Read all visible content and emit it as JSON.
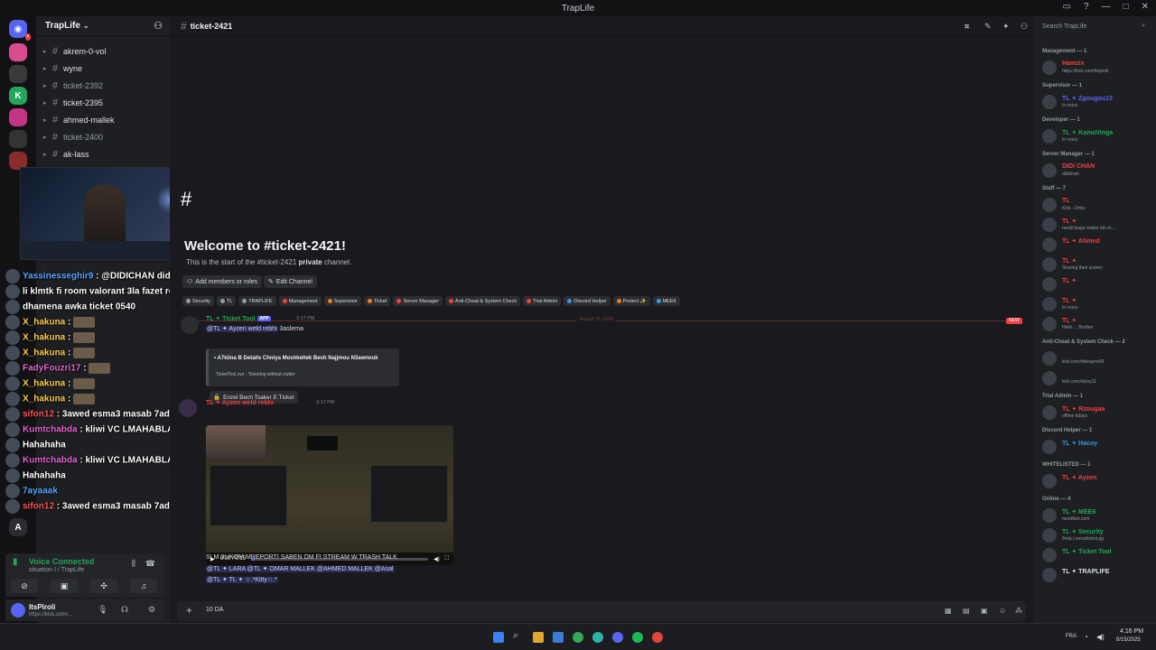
{
  "window": {
    "title": "TrapLife"
  },
  "server": {
    "name": "TrapLife"
  },
  "channels": [
    {
      "name": "akrem-0-vol",
      "bright": true
    },
    {
      "name": "wyne",
      "bright": true
    },
    {
      "name": "ticket-2392",
      "bright": false
    },
    {
      "name": "ticket-2395",
      "bright": true
    },
    {
      "name": "ahmed-mallek",
      "bright": true
    },
    {
      "name": "ticket-2400",
      "bright": false
    },
    {
      "name": "ak-lass",
      "bright": true
    }
  ],
  "stream_chat": [
    {
      "name": "Yassinesseghir9",
      "text": " : @DIDICHAN didi ena",
      "color": "blue"
    },
    {
      "name": "",
      "text": "li klmtk fi room valorant 3la fazet remove",
      "color": ""
    },
    {
      "name": "",
      "text": "dhamena awka ticket 0540",
      "color": ""
    },
    {
      "name": "X_hakuna",
      "text": " :",
      "color": "yellow"
    },
    {
      "name": "X_hakuna",
      "text": " :",
      "color": "yellow"
    },
    {
      "name": "X_hakuna",
      "text": " :",
      "color": "yellow"
    },
    {
      "name": "FadyFouzri17",
      "text": " :",
      "color": "pink"
    },
    {
      "name": "X_hakuna",
      "text": " :",
      "color": "yellow"
    },
    {
      "name": "X_hakuna",
      "text": " :",
      "color": "yellow"
    },
    {
      "name": "sifon12",
      "text": " : 3awed esma3 masab 7ad",
      "color": "red"
    },
    {
      "name": "Kumtchabda",
      "text": " : kliwi VC LMAHABLA",
      "color": "pink"
    },
    {
      "name": "",
      "text": "Hahahaha",
      "color": ""
    },
    {
      "name": "Kumtchabda",
      "text": " : kliwi VC LMAHABLA",
      "color": "pink"
    },
    {
      "name": "",
      "text": "Hahahaha",
      "color": ""
    },
    {
      "name": "7ayaaak",
      "text": "",
      "color": "blue"
    },
    {
      "name": "sifon12",
      "text": " : 3awed esma3 masab 7ad",
      "color": "red"
    }
  ],
  "voice": {
    "status": "Voice Connected",
    "channel": "situation I / TrapLife"
  },
  "user": {
    "name": "ItsPiroli",
    "status": "https://kick.com/..."
  },
  "main": {
    "channel_name": "ticket-2421",
    "welcome_title": "Welcome to #ticket-2421!",
    "welcome_sub_prefix": "This is the start of the #ticket-2421 ",
    "welcome_sub_bold": "private",
    "welcome_sub_suffix": " channel.",
    "add_members_label": "Add members or roles",
    "edit_channel_label": "Edit Channel",
    "role_tags": [
      {
        "label": "Security",
        "color": "#949ba4"
      },
      {
        "label": "TL",
        "color": "#949ba4"
      },
      {
        "label": "TRAPLIFE",
        "color": "#949ba4"
      },
      {
        "label": "Management",
        "color": "#f23f43"
      },
      {
        "label": "Supervisor",
        "color": "#e67e22"
      },
      {
        "label": "Ticket",
        "color": "#e67e22"
      },
      {
        "label": "Server Manager",
        "color": "#f23f43"
      },
      {
        "label": "Anti-Cheat & System Check",
        "color": "#f23f43"
      },
      {
        "label": "Trial Admin",
        "color": "#f23f43"
      },
      {
        "label": "Discord Helper",
        "color": "#3498db"
      },
      {
        "label": "Protect ✨",
        "color": "#e67e22"
      },
      {
        "label": "MEE6",
        "color": "#3498db"
      }
    ],
    "date_divider": "August 15, 2025",
    "new_label": "NEW",
    "messages": {
      "bot": {
        "author": "TL ✦ Ticket Tool",
        "badge": "APP",
        "time": "3:17 PM",
        "mention_user": "@TL ✦ Ayzen weld rebhi",
        "text_after": " 3aslema",
        "embed_title": "• A7kiina B Details Chniya Moshkeltek Bech Najjmou N3awnouk",
        "embed_footer": "TicketTool.xyz - Ticketing without clutter",
        "button_label": "Enzel Bech Tsaker E Ticket"
      },
      "user": {
        "author": "TL ✦ Ayzen weld rebhi",
        "time": "3:17 PM",
        "video_time": "0:00 / 0:15",
        "video_progress": 0.0,
        "text_line1": "SLM 3LIKOM MREPORTI  SABEN OM FI STREAM W TRASH TALK",
        "mentions_line2": "@TL ✦ LARA  @TL ✦ OMAR MALLEK  @AHMED MALLEK  @Asal",
        "mentions_line3": "@TL ✦ TL ✦ ☆.*Kitty☆.*"
      }
    },
    "composer_value": "10 DA"
  },
  "members": {
    "search_placeholder": "Search TrapLife",
    "groups": [
      {
        "title": "Management — 1",
        "members": [
          {
            "name": "Hamzix",
            "status": "https://kick.com/itspiroli",
            "color": "#f23f43"
          }
        ]
      },
      {
        "title": "Supervisor — 1",
        "members": [
          {
            "name": "TL ✦ Zgougou13",
            "status": "In voice",
            "color": "#5865f2"
          }
        ]
      },
      {
        "title": "Developer — 1",
        "members": [
          {
            "name": "TL ✦ KamaVinga",
            "status": "In voice",
            "color": "#23a55a"
          }
        ]
      },
      {
        "title": "Server Manager — 1",
        "members": [
          {
            "name": "DIDI CHAN",
            "status": "didichan",
            "color": "#f23f43"
          }
        ]
      },
      {
        "title": "Staff — 7",
        "members": [
          {
            "name": "TL",
            "status": "Kick : Zmfa",
            "color": "#f23f43"
          },
          {
            "name": "TL ✦",
            "status": "medii blage maker bih el...",
            "color": "#f23f43"
          },
          {
            "name": "TL ✦ Ahmed",
            "status": "",
            "color": "#f23f43"
          },
          {
            "name": "TL ✦",
            "status": "Sharing their screen",
            "color": "#f23f43"
          },
          {
            "name": "TL ✦",
            "status": "",
            "color": "#f23f43"
          },
          {
            "name": "TL ✦",
            "status": "In voice",
            "color": "#f23f43"
          },
          {
            "name": "TL ✦",
            "status": "Hello ... Brother",
            "color": "#f23f43"
          }
        ]
      },
      {
        "title": "Anti-Cheat & System Check — 2",
        "members": [
          {
            "name": "",
            "status": "kick.com/ddwayne69",
            "color": "#f23f43"
          },
          {
            "name": "",
            "status": "kick.com/stony11",
            "color": "#f23f43"
          }
        ]
      },
      {
        "title": "Trial Admin — 1",
        "members": [
          {
            "name": "TL ✦ Rzougaa",
            "status": "offline bdays",
            "color": "#f23f43"
          }
        ]
      },
      {
        "title": "Discord Helper — 1",
        "members": [
          {
            "name": "TL ✦ Hacoy",
            "status": "",
            "color": "#3498db"
          }
        ]
      },
      {
        "title": "WHITELISTED — 1",
        "members": [
          {
            "name": "TL ✦ Ayzen",
            "status": "",
            "color": "#f23f43"
          }
        ]
      },
      {
        "title": "Online — 4",
        "members": [
          {
            "name": "TL ✦ MEE6",
            "status": "mee6bot.com",
            "color": "#23a55a"
          },
          {
            "name": "TL ✦ Security",
            "status": "/help | securitybot.gg",
            "color": "#23a55a"
          },
          {
            "name": "TL ✦ Ticket Tool",
            "status": "",
            "color": "#23a55a"
          },
          {
            "name": "TL ✦ TRAPLIFE",
            "status": "",
            "color": "#dbdee1"
          }
        ]
      }
    ]
  },
  "taskbar": {
    "lang": "FRA",
    "time": "4:16 PM",
    "date": "8/15/2025"
  }
}
